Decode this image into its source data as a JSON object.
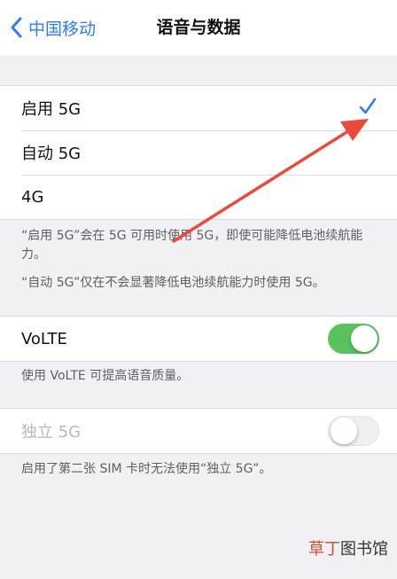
{
  "navbar": {
    "back_label": "中国移动",
    "title": "语音与数据"
  },
  "network_options": [
    {
      "label": "启用 5G",
      "selected": true
    },
    {
      "label": "自动 5G",
      "selected": false
    },
    {
      "label": "4G",
      "selected": false
    }
  ],
  "network_notes": [
    "“启用 5G”会在 5G 可用时使用 5G，即使可能降低电池续航能力。",
    "“自动 5G”仅在不会显著降低电池续航能力时使用 5G。"
  ],
  "volte": {
    "label": "VoLTE",
    "enabled": true,
    "note": "使用 VoLTE 可提高语音质量。"
  },
  "sa_5g": {
    "label": "独立 5G",
    "enabled": false,
    "disabled": true,
    "note": "启用了第二张 SIM 卡时无法使用“独立 5G”。"
  },
  "watermark": {
    "red_part": "草丁",
    "dark_part": "图书馆"
  },
  "colors": {
    "accent": "#2f7cf6",
    "toggle_on": "#5ac35e",
    "annotation_arrow": "#e84a3c"
  }
}
